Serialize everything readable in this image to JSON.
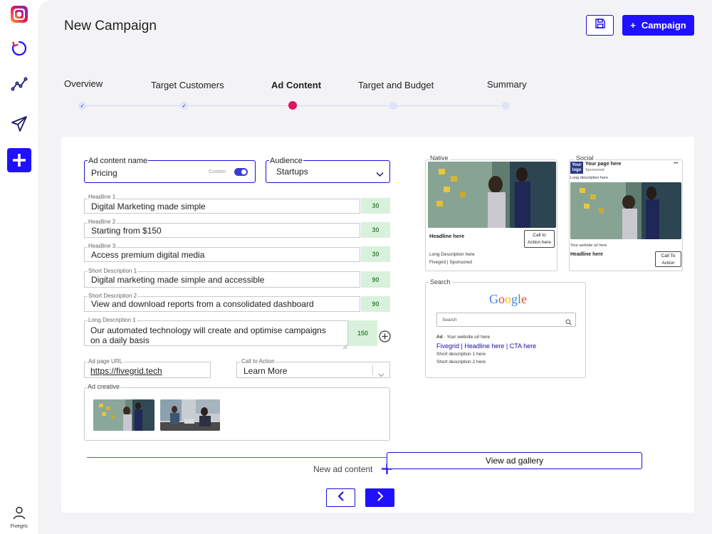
{
  "sidebar": {
    "user_label": "Fivegric"
  },
  "header": {
    "title": "New Campaign",
    "campaign_button_label": "Campaign",
    "campaign_button_plus": "+"
  },
  "stepper": {
    "steps": [
      {
        "label": "Overview",
        "state": "done"
      },
      {
        "label": "Target Customers",
        "state": "done"
      },
      {
        "label": "Ad Content",
        "state": "current"
      },
      {
        "label": "Target and Budget",
        "state": "upcoming"
      },
      {
        "label": "Summary",
        "state": "upcoming"
      }
    ],
    "check_glyph": "✓"
  },
  "form": {
    "ad_content_name": {
      "label": "Ad content name",
      "value": "Pricing",
      "toggle_label": "Custom",
      "toggle_on": true
    },
    "audience": {
      "label": "Audience",
      "value": "Startups"
    },
    "headline1": {
      "label": "Headline 1",
      "value": "Digital Marketing made simple",
      "count": "30"
    },
    "headline2": {
      "label": "Headline 2",
      "value": "Starting from $150",
      "count": "30"
    },
    "headline3": {
      "label": "Headline 3",
      "value": "Access premium digital media",
      "count": "30"
    },
    "short1": {
      "label": "Short Description 1",
      "value": "Digital marketing made simple and accessible",
      "count": "90"
    },
    "short2": {
      "label": "Short Description 2",
      "value": "View and download reports from a consolidated dashboard",
      "count": "90"
    },
    "long1": {
      "label": "Long Description 1",
      "line1": "Our automated technology will create and optimise campaigns",
      "line2": "on a daily basis",
      "count": "150"
    },
    "page_url": {
      "label": "Ad page URL",
      "value": "https://fivegrid.tech"
    },
    "cta": {
      "label": "Call to Action",
      "value": "Learn More"
    },
    "creative": {
      "label": "Ad creative"
    },
    "new_ad_content": "New ad content"
  },
  "previews": {
    "native": {
      "label": "Native",
      "headline": "Headline here",
      "cta": [
        "Call to",
        "Action here"
      ],
      "long_desc": "Long Description here",
      "sponsor": "Fivegrid | Sponsored"
    },
    "social": {
      "label": "Social",
      "logo": [
        "Your",
        "logo"
      ],
      "page": "Your page here",
      "sponsored": "Sponsored",
      "long_desc": "Long description here",
      "website": "Your website url here",
      "headline": "Headline here",
      "cta": [
        "Call To",
        "Action"
      ],
      "menu": "•••"
    },
    "search": {
      "label": "Search",
      "search_placeholder": "Search",
      "ad_tag": "Ad",
      "ad_url": " · Your website url here",
      "headline": "Fivegrid | Headline here | CTA here",
      "desc1": "Short description 1 here",
      "desc2": "Short description 2 here",
      "brand_letters": [
        "G",
        "o",
        "o",
        "g",
        "l",
        "e"
      ],
      "brand_colors": [
        "#4285F4",
        "#EA4335",
        "#FBBC05",
        "#4285F4",
        "#34A853",
        "#EA4335"
      ]
    },
    "gallery_button": "View ad gallery"
  },
  "colors": {
    "accent": "#1f10ff",
    "current_step": "#e1155a",
    "counter_bg": "#d9f1dc",
    "counter_text": "#3b8a45",
    "search_link": "#1a0dab"
  }
}
